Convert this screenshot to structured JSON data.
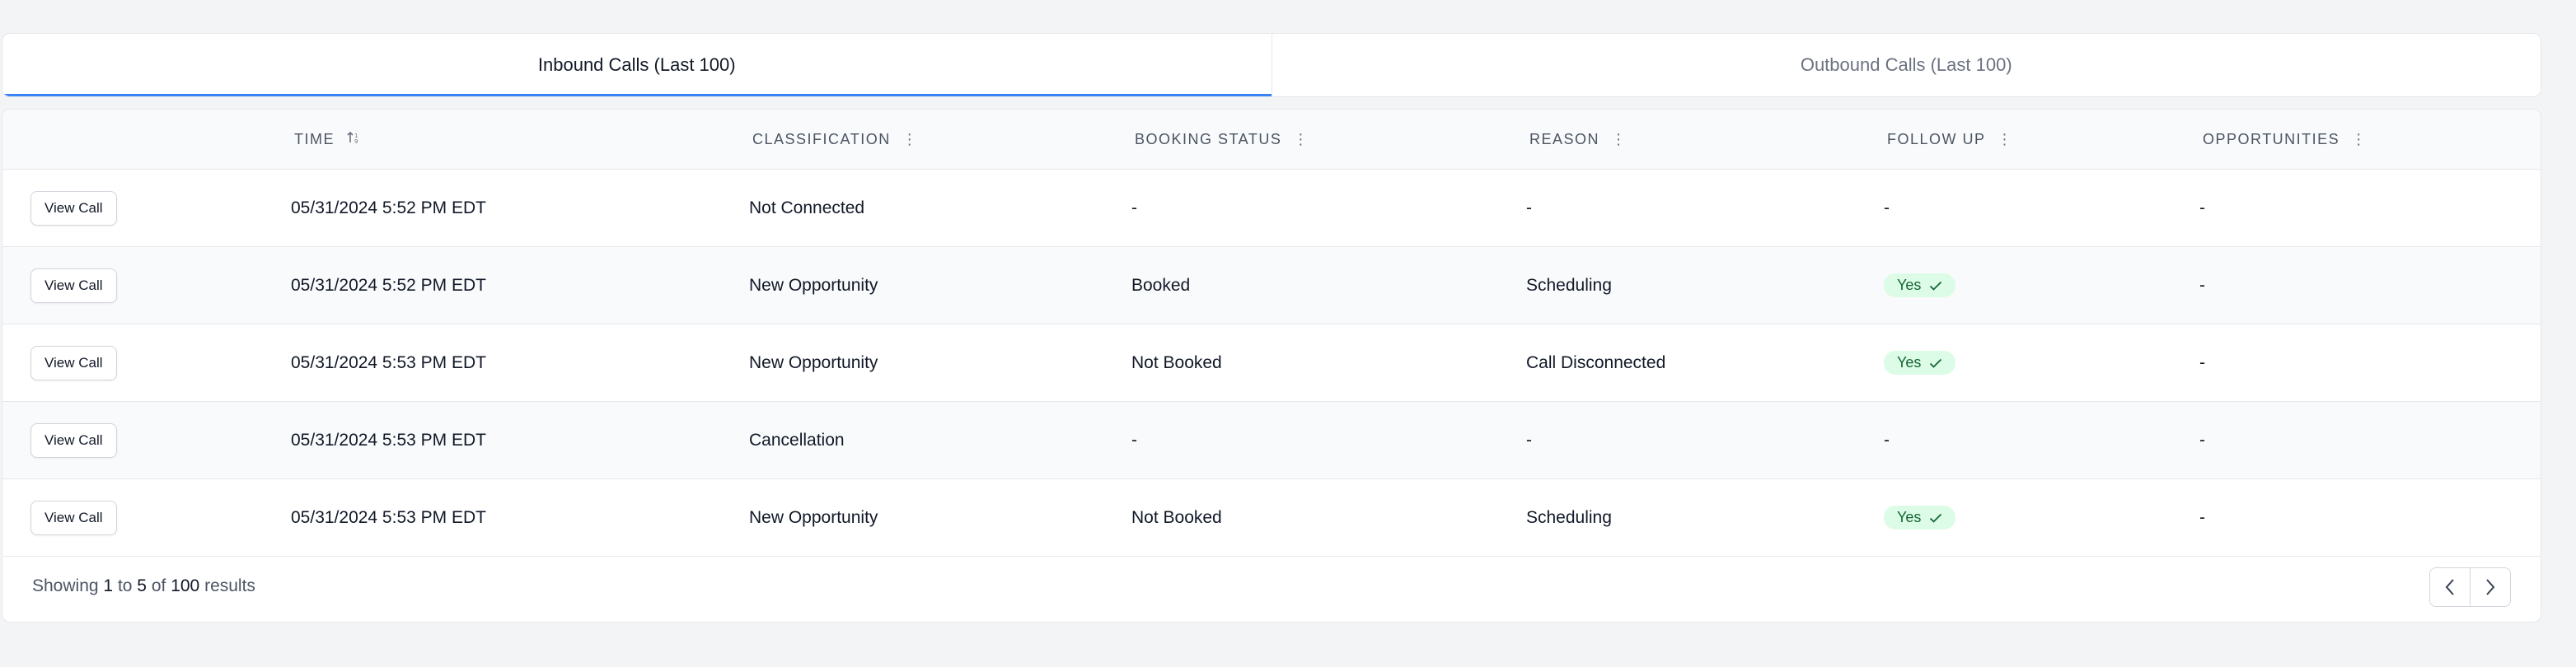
{
  "tabs": [
    {
      "label": "Inbound Calls (Last 100)",
      "active": true
    },
    {
      "label": "Outbound Calls (Last 100)",
      "active": false
    }
  ],
  "table": {
    "columns": {
      "time": "Time",
      "classification": "Classification",
      "booking_status": "Booking Status",
      "reason": "Reason",
      "follow_up": "Follow Up",
      "opportunities": "Opportunities"
    },
    "rows": [
      {
        "action": "View Call",
        "time": "05/31/2024 5:52 PM EDT",
        "classification": "Not Connected",
        "booking_status": "-",
        "reason": "-",
        "follow_up": "-",
        "opportunities": "-"
      },
      {
        "action": "View Call",
        "time": "05/31/2024 5:52 PM EDT",
        "classification": "New Opportunity",
        "booking_status": "Booked",
        "reason": "Scheduling",
        "follow_up": "Yes",
        "opportunities": "-"
      },
      {
        "action": "View Call",
        "time": "05/31/2024 5:53 PM EDT",
        "classification": "New Opportunity",
        "booking_status": "Not Booked",
        "reason": "Call Disconnected",
        "follow_up": "Yes",
        "opportunities": "-"
      },
      {
        "action": "View Call",
        "time": "05/31/2024 5:53 PM EDT",
        "classification": "Cancellation",
        "booking_status": "-",
        "reason": "-",
        "follow_up": "-",
        "opportunities": "-"
      },
      {
        "action": "View Call",
        "time": "05/31/2024 5:53 PM EDT",
        "classification": "New Opportunity",
        "booking_status": "Not Booked",
        "reason": "Scheduling",
        "follow_up": "Yes",
        "opportunities": "-"
      }
    ]
  },
  "footer": {
    "prefix": "Showing",
    "from": "1",
    "to_word": "to",
    "to": "5",
    "of_word": "of",
    "total": "100",
    "suffix": "results"
  },
  "icons": {
    "sort": "sort-icon",
    "column_menu": "kebab-menu-icon",
    "check": "check-icon",
    "prev": "chevron-left-icon",
    "next": "chevron-right-icon"
  },
  "colors": {
    "accent": "#3b82f6",
    "badge_bg": "#dcfce7",
    "badge_text": "#166534"
  }
}
